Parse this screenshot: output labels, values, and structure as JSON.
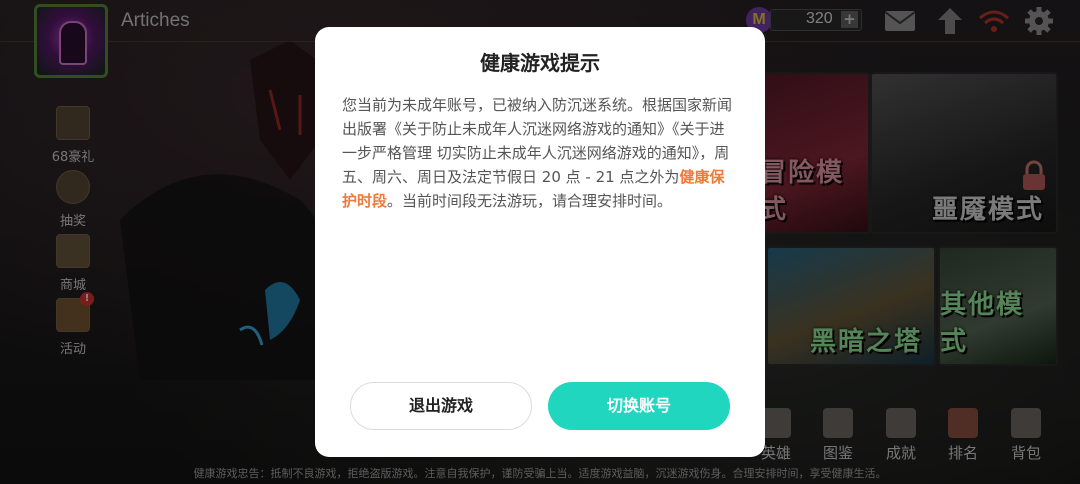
{
  "header": {
    "player_name": "Artiches",
    "currency_badge": "M",
    "currency_value": "320",
    "plus_label": "+"
  },
  "sidebar": {
    "items": [
      {
        "label": "68豪礼"
      },
      {
        "label": "抽奖"
      },
      {
        "label": "商城"
      },
      {
        "label": "活动",
        "alert": "!"
      }
    ]
  },
  "modes": {
    "adventure": "冒险模式",
    "nightmare": "噩魇模式",
    "tower": "黑暗之塔",
    "other": "其他模式"
  },
  "bottom_nav": [
    {
      "label": "英雄"
    },
    {
      "label": "图鉴"
    },
    {
      "label": "成就"
    },
    {
      "label": "排名"
    },
    {
      "label": "背包"
    }
  ],
  "ticker": "健康游戏忠告：抵制不良游戏，拒绝盗版游戏。注意自我保护，谨防受骗上当。适度游戏益脑，沉迷游戏伤身。合理安排时间，享受健康生活。",
  "dialog": {
    "title": "健康游戏提示",
    "body_before": "您当前为未成年账号，已被纳入防沉迷系统。根据国家新闻出版署《关于防止未成年人沉迷网络游戏的通知》《关于进一步严格管理 切实防止未成年人沉迷网络游戏的通知》，周五、周六、周日及法定节假日 20 点 - 21 点之外为",
    "body_highlight": "健康保护时段",
    "body_after": "。当前时间段无法游玩，请合理安排时间。",
    "exit_label": "退出游戏",
    "switch_label": "切换账号"
  },
  "colors": {
    "accent": "#21d6bf",
    "highlight": "#f07a3a"
  },
  "icons": [
    "mail-icon",
    "settings-icon",
    "wifi-icon",
    "upgrade-icon",
    "gift-icon",
    "lottery-icon",
    "cart-icon",
    "event-icon",
    "hero-icon",
    "codex-icon",
    "trophy-icon",
    "rank-icon",
    "backpack-icon"
  ]
}
